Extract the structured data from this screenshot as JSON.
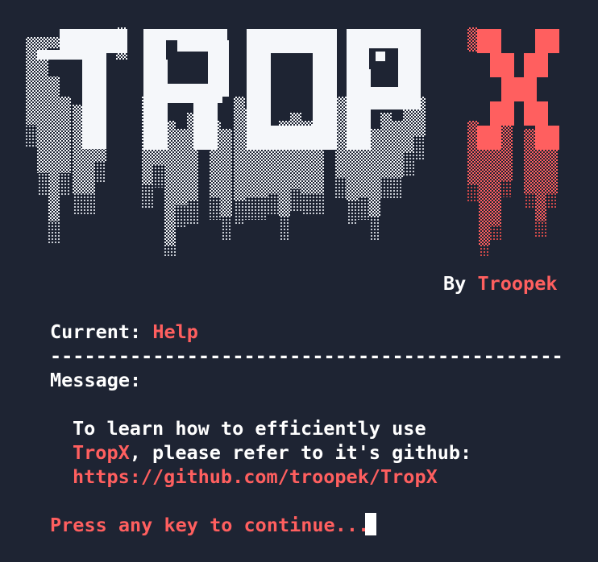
{
  "logo": {
    "word_white": "TROP",
    "word_red": "X",
    "white_color": "#f5f7fa",
    "red_color": "#ff5f5f"
  },
  "byline": {
    "prefix": "By ",
    "author": "Troopek"
  },
  "status": {
    "label": "Current: ",
    "value": "Help"
  },
  "separator": "---------------------------------------------",
  "message": {
    "label": "Message:",
    "line1": "To learn how to efficiently use",
    "line2_accent": "TropX",
    "line2_rest": ", please refer to it's github:",
    "link": "https://github.com/troopek/TropX"
  },
  "prompt": {
    "text": "Press any key to continue...",
    "cursor_visible": true
  },
  "colors": {
    "background": "#1e2433",
    "text": "#ffffff",
    "accent": "#ff5f5f"
  }
}
